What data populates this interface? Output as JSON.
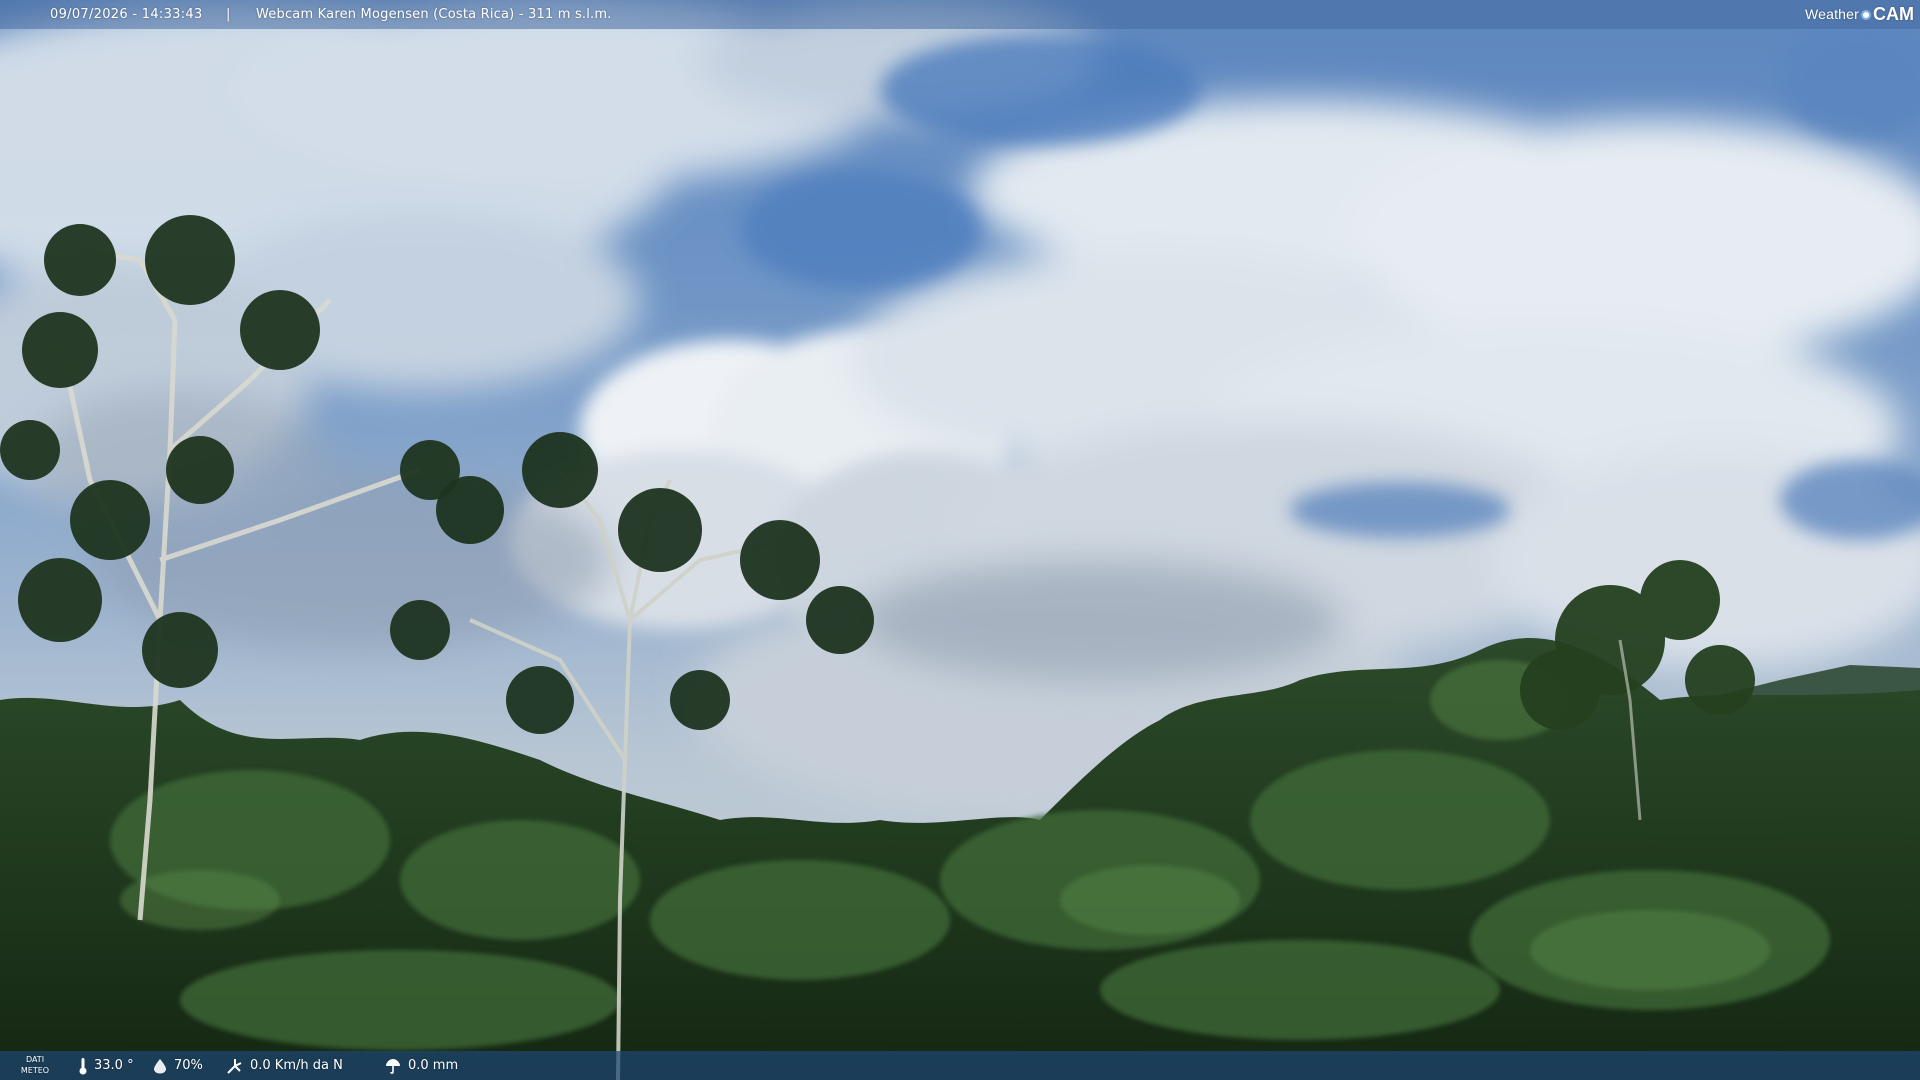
{
  "header": {
    "timestamp": "09/07/2026 - 14:33:43",
    "separator": "|",
    "title": "Webcam Karen Mogensen (Costa Rica) - 311 m s.l.m.",
    "brand_left": "Weather",
    "brand_right": "CAM"
  },
  "footer": {
    "label": "DATI METEO",
    "temperature": "33.0 °",
    "humidity": "70%",
    "wind": "0.0 Km/h da N",
    "rain": "0.0 mm"
  },
  "icons": {
    "temperature": "thermometer-icon",
    "humidity": "drop-icon",
    "wind": "wind-icon",
    "rain": "rain-icon"
  },
  "colors": {
    "sky": "#5d86be",
    "cloud": "#e8eef3",
    "foliage": "#1f3a20",
    "bar": "#1e4673"
  }
}
